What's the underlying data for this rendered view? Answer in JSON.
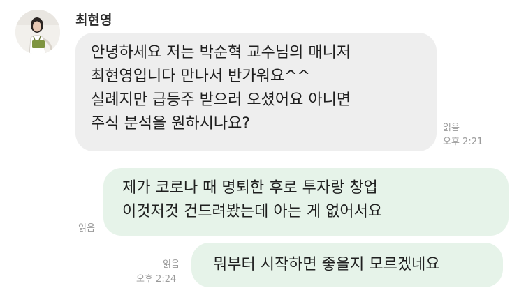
{
  "chat": {
    "sender_name": "최현영",
    "messages": [
      {
        "direction": "incoming",
        "lines": [
          "안녕하세요 저는 박순혁 교수님의 매니저",
          "최현영입니다 만나서 반가워요^^",
          "실례지만 급등주 받으러 오셨어요 아니면",
          "주식 분석을 원하시나요?"
        ],
        "read_label": "읽음",
        "time": "오후 2:21"
      },
      {
        "direction": "outgoing",
        "lines": [
          "제가 코로나 때 명퇴한 후로 투자랑 창업",
          "이것저것 건드려봤는데 아는 게 없어서요"
        ],
        "read_label": "읽음"
      },
      {
        "direction": "outgoing",
        "lines": [
          "뭐부터 시작하면 좋을지 모르겠네요"
        ],
        "read_label": "읽음",
        "time": "오후 2:24"
      }
    ]
  },
  "colors": {
    "incoming_bubble": "#eeeeee",
    "outgoing_bubble": "#e6f3e9",
    "meta_text": "#9a9a9a"
  },
  "icons": {
    "avatar": "profile-photo-avatar"
  }
}
